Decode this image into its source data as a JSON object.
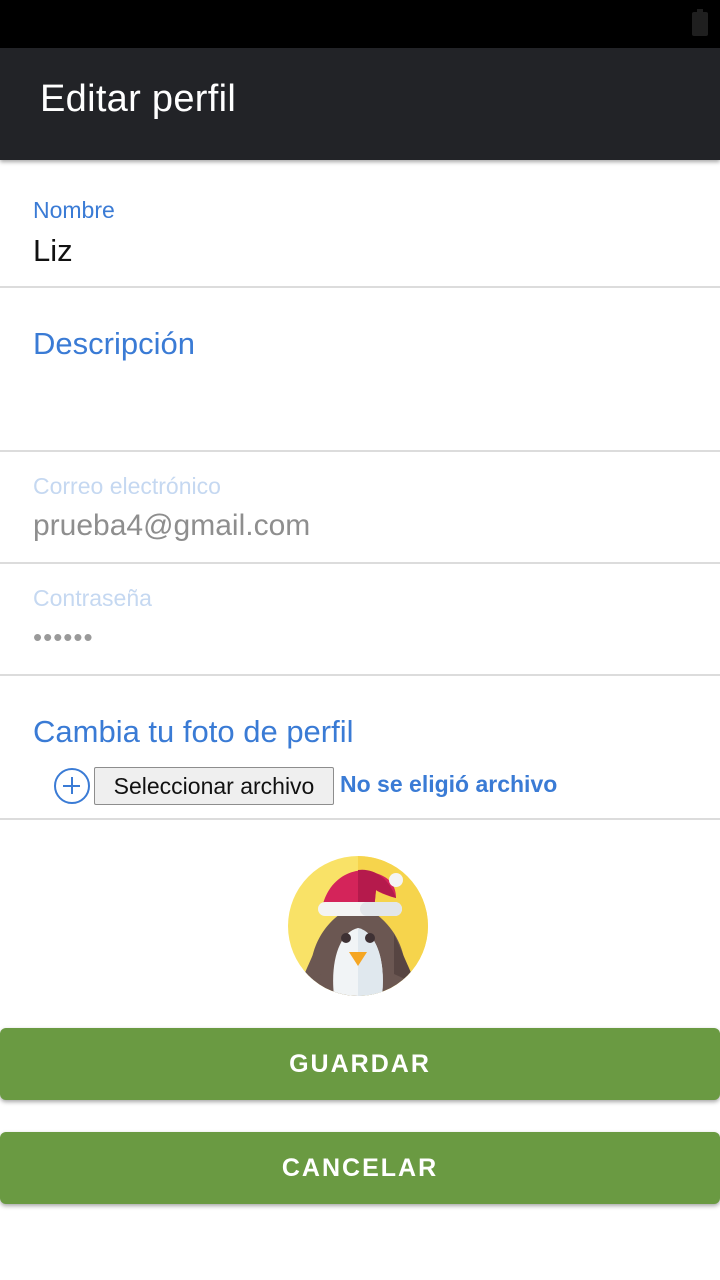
{
  "status_bar": {
    "battery_icon": "battery-icon"
  },
  "app_bar": {
    "title": "Editar perfil"
  },
  "form": {
    "name": {
      "label": "Nombre",
      "value": "Liz"
    },
    "description": {
      "label": "Descripción",
      "value": ""
    },
    "email": {
      "label": "Correo electrónico",
      "value": "prueba4@gmail.com"
    },
    "password": {
      "label": "Contraseña",
      "value": "••••••"
    },
    "photo": {
      "label": "Cambia tu foto de perfil",
      "add_icon": "add-circle-icon",
      "button_label": "Seleccionar archivo",
      "status": "No se eligió archivo"
    }
  },
  "avatar": {
    "icon": "penguin-santa-hat-avatar"
  },
  "actions": {
    "save_label": "GUARDAR",
    "cancel_label": "CANCELAR"
  },
  "colors": {
    "accent": "#3a7bd5",
    "app_bar": "#222327",
    "button": "#6a9a42",
    "disabled_label": "#c5d8f1"
  }
}
